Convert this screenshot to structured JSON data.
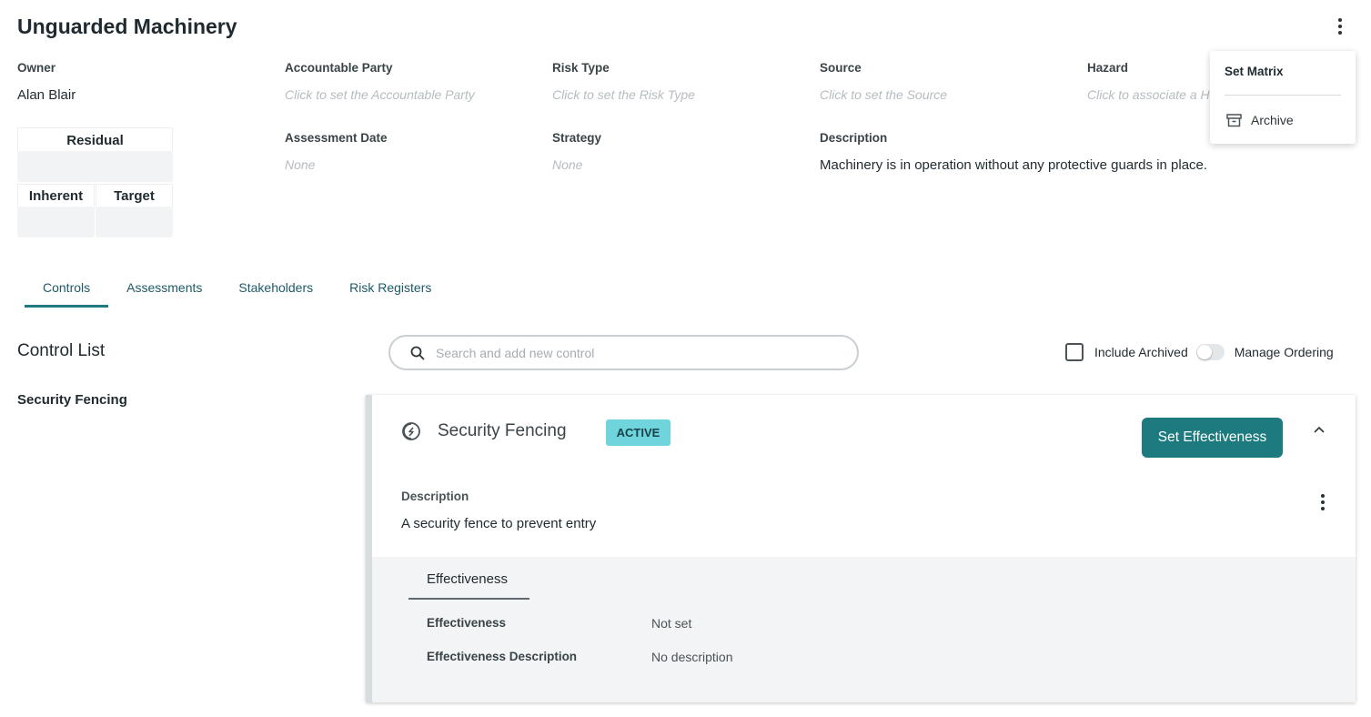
{
  "header": {
    "title": "Unguarded Machinery"
  },
  "fields": {
    "owner": {
      "label": "Owner",
      "value": "Alan Blair"
    },
    "accountable_party": {
      "label": "Accountable Party",
      "placeholder": "Click to set the Accountable Party"
    },
    "risk_type": {
      "label": "Risk Type",
      "placeholder": "Click to set the Risk Type"
    },
    "source": {
      "label": "Source",
      "placeholder": "Click to set the Source"
    },
    "hazard": {
      "label": "Hazard",
      "placeholder": "Click to associate a Hazard"
    },
    "assessment_date": {
      "label": "Assessment Date",
      "value": "None"
    },
    "strategy": {
      "label": "Strategy",
      "value": "None"
    },
    "description": {
      "label": "Description",
      "value": "Machinery is in operation without any protective guards in place."
    }
  },
  "matrix": {
    "residual": "Residual",
    "inherent": "Inherent",
    "target": "Target"
  },
  "dropdown": {
    "set_matrix": "Set Matrix",
    "archive": "Archive"
  },
  "tabs": [
    {
      "label": "Controls",
      "active": true
    },
    {
      "label": "Assessments",
      "active": false
    },
    {
      "label": "Stakeholders",
      "active": false
    },
    {
      "label": "Risk Registers",
      "active": false
    }
  ],
  "controls": {
    "title": "Control List",
    "search_placeholder": "Search and add new control",
    "include_archived": "Include Archived",
    "manage_ordering": "Manage Ordering",
    "list_items": [
      "Security Fencing"
    ]
  },
  "control_card": {
    "title": "Security Fencing",
    "status": "ACTIVE",
    "set_effectiveness": "Set Effectiveness",
    "description_label": "Description",
    "description": "A security fence to prevent entry",
    "effectiveness_tab": "Effectiveness",
    "effectiveness_label": "Effectiveness",
    "effectiveness_value": "Not set",
    "effectiveness_description_label": "Effectiveness Description",
    "effectiveness_description_value": "No description"
  },
  "colors": {
    "accent": "#1d7a7e",
    "badge": "#6fd4dc",
    "tab_text": "#1d5a67"
  }
}
